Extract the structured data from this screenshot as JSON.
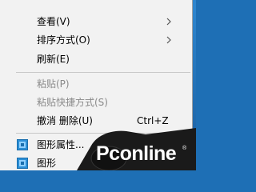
{
  "context_menu": {
    "items": [
      {
        "label": "查看(V)",
        "has_submenu": true,
        "enabled": true
      },
      {
        "label": "排序方式(O)",
        "has_submenu": true,
        "enabled": true
      },
      {
        "label": "刷新(E)",
        "enabled": true
      },
      {
        "label": "粘贴(P)",
        "enabled": false
      },
      {
        "label": "粘贴快捷方式(S)",
        "enabled": false
      },
      {
        "label": "撤消 删除(U)",
        "shortcut": "Ctrl+Z",
        "enabled": true
      },
      {
        "label": "图形属性...",
        "icon": "graphics-properties-icon",
        "enabled": true
      },
      {
        "label": "图形",
        "icon": "graphics-options-icon",
        "enabled": true
      }
    ]
  },
  "watermark": {
    "text": "Pconline",
    "mark": "®",
    "brand_color": "#1a1a1a"
  }
}
